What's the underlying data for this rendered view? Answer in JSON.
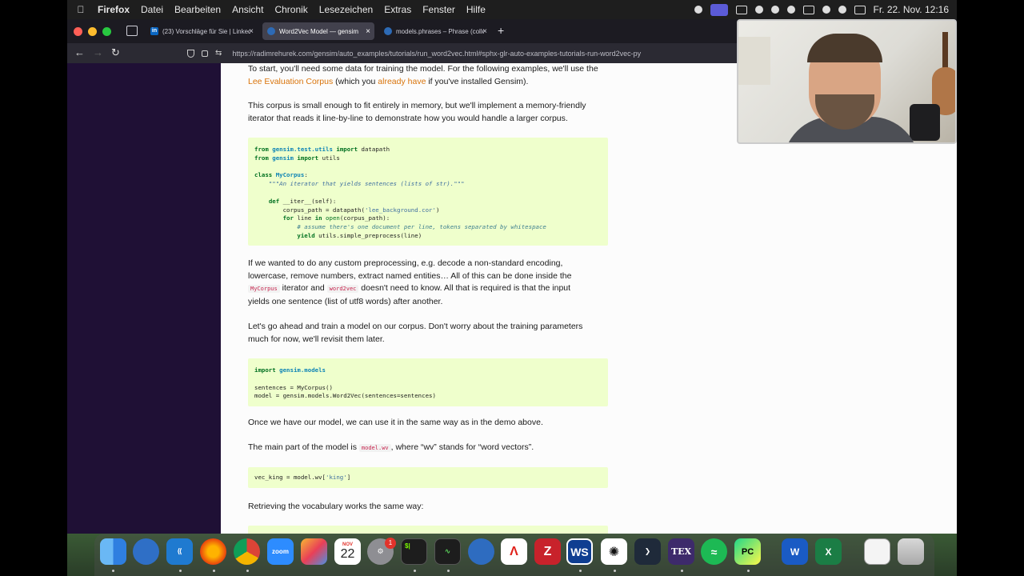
{
  "menubar": {
    "app_name": "Firefox",
    "items": [
      "Datei",
      "Bearbeiten",
      "Ansicht",
      "Chronik",
      "Lesezeichen",
      "Extras",
      "Fenster",
      "Hilfe"
    ],
    "clock": "Fr. 22. Nov.  12:16"
  },
  "tabs": [
    {
      "title": "(23) Vorschläge für Sie | LinkedI",
      "favicon": "linkedin-icon",
      "active": false
    },
    {
      "title": "Word2Vec Model — gensim",
      "favicon": "gensim-icon",
      "active": true
    },
    {
      "title": "models.phrases – Phrase (colloc",
      "favicon": "gensim-icon",
      "active": false
    }
  ],
  "url": "https://radimrehurek.com/gensim/auto_examples/tutorials/run_word2vec.html#sphx-glr-auto-examples-tutorials-run-word2vec-py",
  "article": {
    "p1_a": "To start, you'll need some data for training the model. For the following examples, we'll use the",
    "p1_link1": "Lee Evaluation Corpus",
    "p1_b": " (which you ",
    "p1_link2": "already have",
    "p1_c": " if you've installed Gensim).",
    "p2_a": "This corpus is small enough to fit entirely in memory, but we'll implement a memory-friendly",
    "p2_b": "iterator that reads it line-by-line to demonstrate how you would handle a larger corpus.",
    "p3_a": "If we wanted to do any custom preprocessing, e.g. decode a non-standard encoding,",
    "p3_b": "lowercase, remove numbers, extract named entities… All of this can be done inside the",
    "p3_code1": "MyCorpus",
    "p3_c": " iterator and ",
    "p3_code2": "word2vec",
    "p3_d": " doesn't need to know. All that is required is that the input",
    "p3_e": "yields one sentence (list of utf8 words) after another.",
    "p4_a": "Let's go ahead and train a model on our corpus. Don't worry about the training parameters",
    "p4_b": "much for now, we'll revisit them later.",
    "p5": "Once we have our model, we can use it in the same way as in the demo above.",
    "p6_a": "The main part of the model is ",
    "p6_code": "model.wv",
    "p6_b": ", where “wv” stands for “word vectors”.",
    "p7": "Retrieving the vocabulary works the same way:"
  },
  "code1": {
    "l1_kw": "from",
    "l1_mod": "gensim.test.utils",
    "l1_kw2": "import",
    "l1_rest": "datapath",
    "l2_kw": "from",
    "l2_mod": "gensim",
    "l2_kw2": "import",
    "l2_rest": "utils",
    "l4_kw": "class",
    "l4_cls": "MyCorpus",
    "l4_rest": ":",
    "l5_doc": "\"\"\"An iterator that yields sentences (lists of str).\"\"\"",
    "l7_kw": "def",
    "l7_rest": "__iter__(self):",
    "l8_a": "corpus_path = datapath(",
    "l8_str": "'lee_background.cor'",
    "l8_b": ")",
    "l9_kw": "for",
    "l9_a": "line",
    "l9_kw2": "in",
    "l9_bi": "open",
    "l9_b": "(corpus_path):",
    "l10_cm": "# assume there's one document per line, tokens separated by whitespace",
    "l11_kw": "yield",
    "l11_rest": "utils.simple_preprocess(line)"
  },
  "code2": {
    "l1_kw": "import",
    "l1_mod": "gensim.models",
    "l3": "sentences = MyCorpus()",
    "l4": "model = gensim.models.Word2Vec(sentences=sentences)"
  },
  "code3": {
    "l1_a": "vec_king = model.wv[",
    "l1_str": "'king'",
    "l1_b": "]"
  },
  "dock": {
    "calendar_month": "NOV",
    "calendar_day": "22",
    "settings_badge": "1",
    "zoom_label": "zoom",
    "ws_label": "WS",
    "pc_label": "PC",
    "tex_label": "TEX",
    "terminal_label": "$|"
  },
  "colors": {
    "link": "#d9740b",
    "code_bg": "#efffcc",
    "sidebar": "#1f1035"
  }
}
